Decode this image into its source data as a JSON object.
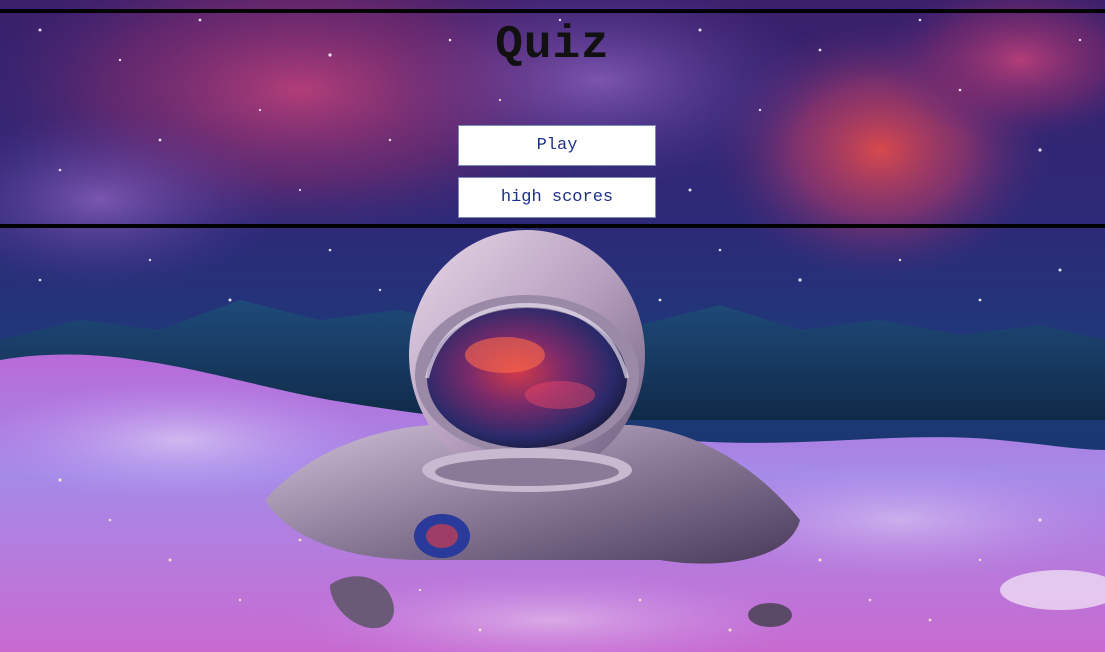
{
  "page": {
    "title": "Quiz"
  },
  "menu": {
    "play_label": "Play",
    "high_scores_label": "high scores"
  },
  "colors": {
    "border": "#000000",
    "button_bg": "#ffffff",
    "button_text": "#1f2f88",
    "button_border": "#7b8bb5",
    "title_text": "#111111"
  },
  "background": {
    "description_icon": "astronaut-in-galaxy-sea-image"
  }
}
